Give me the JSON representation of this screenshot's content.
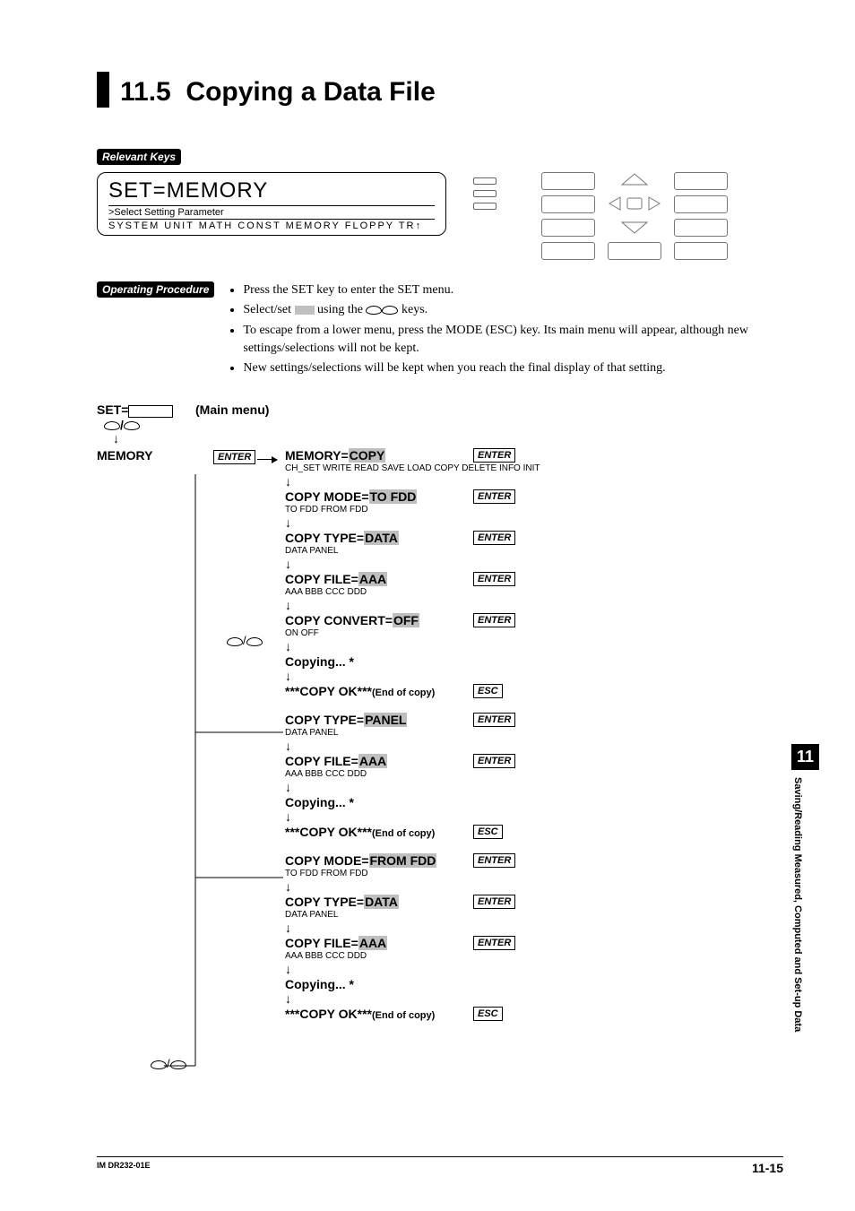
{
  "section_number": "11.5",
  "section_title": "Copying a Data File",
  "relevant_keys_label": "Relevant Keys",
  "operating_procedure_label": "Operating Procedure",
  "lcd": {
    "big": "SET=MEMORY",
    "sub": ">Select Setting Parameter",
    "menu": "SYSTEM  UNIT  MATH  CONST  MEMORY  FLOPPY  TR↑"
  },
  "bullets": {
    "b1_pre": "Press the SET key to enter the SET menu.",
    "b2_pre": "Select/set ",
    "b2_mid": " using the ",
    "b2_post": " keys.",
    "b3": "To escape from a lower menu, press the MODE (ESC) key.  Its main menu will appear, although new settings/selections will not be kept.",
    "b4": "New settings/selections will be kept when you reach the final display of that setting."
  },
  "keys": {
    "enter": "ENTER",
    "esc": "ESC"
  },
  "flow": {
    "set_label": "SET=",
    "main_menu": "(Main menu)",
    "memory_label": "MEMORY",
    "items": [
      {
        "main_pre": "MEMORY=",
        "main_hl": "COPY",
        "sub": "CH_SET WRITE READ SAVE LOAD COPY DELETE INFO INIT",
        "key": "ENTER"
      },
      {
        "main_pre": "COPY MODE=",
        "main_hl": "TO FDD",
        "sub": "TO FDD   FROM FDD",
        "key": "ENTER"
      },
      {
        "main_pre": "COPY TYPE=",
        "main_hl": "DATA",
        "sub": "DATA PANEL",
        "key": "ENTER"
      },
      {
        "main_pre": "COPY FILE=",
        "main_hl": "AAA",
        "sub": "AAA   BBB   CCC   DDD",
        "key": "ENTER"
      },
      {
        "main_pre": "COPY CONVERT=",
        "main_hl": "OFF",
        "sub": "ON OFF",
        "key": "ENTER"
      },
      {
        "main_pre": "Copying...  *",
        "sub": "",
        "key": ""
      },
      {
        "main_pre": "***COPY OK***",
        "end": "(End of copy)",
        "sub": "",
        "key": "ESC"
      },
      {
        "main_pre": "COPY TYPE=",
        "main_hl": "PANEL",
        "sub": "DATA PANEL",
        "key": "ENTER"
      },
      {
        "main_pre": "COPY FILE=",
        "main_hl": "AAA",
        "sub": "AAA   BBB   CCC   DDD",
        "key": "ENTER"
      },
      {
        "main_pre": "Copying...  *",
        "sub": "",
        "key": ""
      },
      {
        "main_pre": "***COPY OK***",
        "end": "(End of copy)",
        "sub": "",
        "key": "ESC"
      },
      {
        "main_pre": "COPY MODE=",
        "main_hl": "FROM FDD",
        "sub": "TO FDD   FROM FDD",
        "key": "ENTER"
      },
      {
        "main_pre": "COPY TYPE=",
        "main_hl": "DATA",
        "sub": "DATA PANEL",
        "key": "ENTER"
      },
      {
        "main_pre": "COPY FILE=",
        "main_hl": "AAA",
        "sub": "AAA   BBB   CCC   DDD",
        "key": "ENTER"
      },
      {
        "main_pre": "Copying...  *",
        "sub": "",
        "key": ""
      },
      {
        "main_pre": "***COPY OK***",
        "end": "(End of copy)",
        "sub": "",
        "key": "ESC"
      }
    ]
  },
  "side_tab": {
    "num": "11",
    "text": "Saving/Reading Measured,\nComputed and Set-up Data"
  },
  "footer": {
    "left": "IM DR232-01E",
    "right": "11-15"
  }
}
